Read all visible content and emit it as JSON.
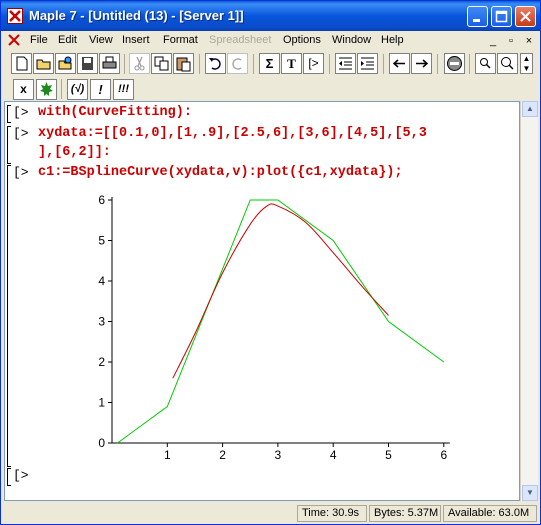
{
  "window": {
    "title": "Maple 7 - [Untitled (13) - [Server 1]]"
  },
  "menu": {
    "items": [
      {
        "label": "File",
        "disabled": false
      },
      {
        "label": "Edit",
        "disabled": false
      },
      {
        "label": "View",
        "disabled": false
      },
      {
        "label": "Insert",
        "disabled": false
      },
      {
        "label": "Format",
        "disabled": false
      },
      {
        "label": "Spreadsheet",
        "disabled": true
      },
      {
        "label": "Options",
        "disabled": false
      },
      {
        "label": "Window",
        "disabled": false
      },
      {
        "label": "Help",
        "disabled": false
      }
    ]
  },
  "toolbar2": {
    "x_label": "x",
    "check_label": "(√)",
    "bang_label": "!",
    "bang3_label": "!!!"
  },
  "toolbar1": {
    "sum_label": "Σ",
    "text_label": "T",
    "prompt_label": "[>"
  },
  "worksheet": {
    "lines": [
      {
        "prompt": "[>",
        "code": "with(CurveFitting):"
      },
      {
        "prompt": "[>",
        "code": "xydata:=[[0.1,0],[1,.9],[2.5,6],[3,6],[4,5],[5,3"
      },
      {
        "prompt": "",
        "code": "],[6,2]]:"
      },
      {
        "prompt": "[>",
        "code": "c1:=BSplineCurve(xydata,v):plot({c1,xydata});"
      }
    ],
    "empty_prompt": "[>"
  },
  "chart_data": {
    "type": "line",
    "xlim": [
      0,
      6
    ],
    "ylim": [
      0,
      6
    ],
    "xticks": [
      1,
      2,
      3,
      4,
      5,
      6
    ],
    "yticks": [
      0,
      1,
      2,
      3,
      4,
      5,
      6
    ],
    "series": [
      {
        "color": "#00cc00",
        "x": [
          0.1,
          1,
          2.5,
          3,
          4,
          5,
          6
        ],
        "y": [
          0,
          0.9,
          6,
          6,
          5,
          3,
          2
        ]
      },
      {
        "color": "#cc0000",
        "x": [
          1.1,
          1.5,
          2.0,
          2.5,
          2.8,
          3.0,
          3.5,
          4.0,
          4.5,
          5.0
        ],
        "y": [
          1.6,
          2.7,
          4.2,
          5.4,
          5.85,
          5.85,
          5.45,
          4.7,
          3.9,
          3.15
        ]
      }
    ]
  },
  "status": {
    "time": "Time: 30.9s",
    "bytes": "Bytes: 5.37M",
    "available": "Available: 63.0M"
  }
}
